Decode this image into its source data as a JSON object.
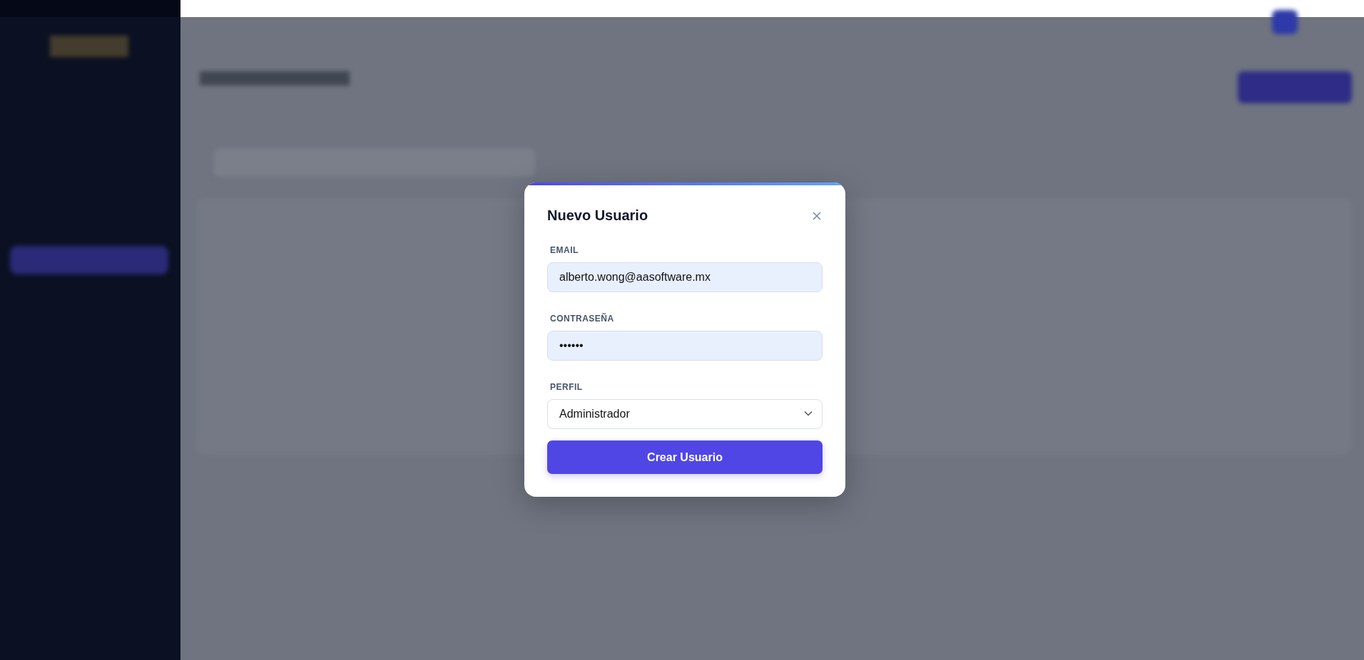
{
  "modal": {
    "title": "Nuevo Usuario",
    "fields": [
      {
        "kind": "input",
        "label": "EMAIL",
        "value": "alberto.wong@aasoftware.mx",
        "autofilled": true
      },
      {
        "kind": "input",
        "label": "CONTRASEÑA",
        "value": "••••••",
        "autofilled": true
      },
      {
        "kind": "select",
        "label": "PERFIL",
        "value": "Administrador",
        "autofilled": false
      }
    ],
    "submit": "Crear Usuario"
  }
}
